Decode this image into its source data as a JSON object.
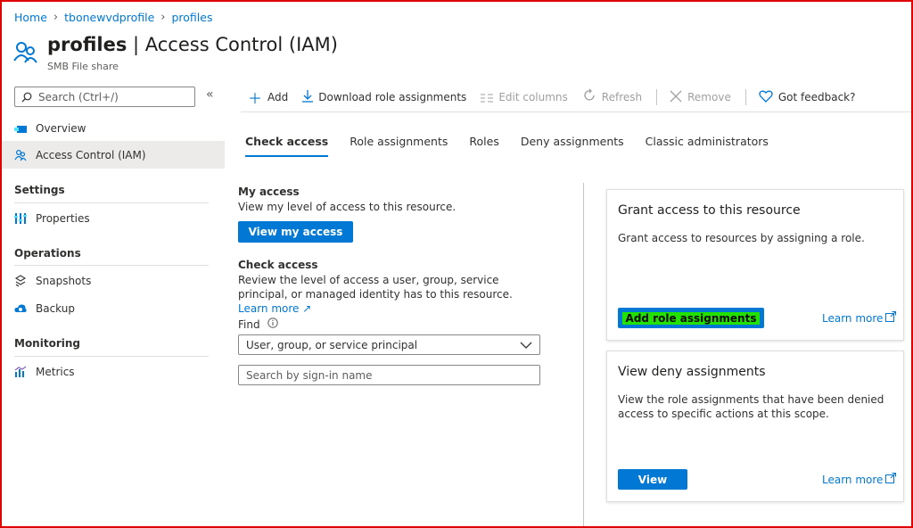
{
  "breadcrumb": [
    "Home",
    "tbonewvdprofile",
    "profiles"
  ],
  "header": {
    "title_bold": "profiles",
    "title_rest": "| Access Control (IAM)",
    "subtitle": "SMB File share"
  },
  "sidebar": {
    "search_placeholder": "Search (Ctrl+/)",
    "collapse_glyph": "«",
    "items": [
      {
        "label": "Overview",
        "icon": "file-share-icon"
      },
      {
        "label": "Access Control (IAM)",
        "icon": "people-icon",
        "active": true
      }
    ],
    "sections": [
      {
        "heading": "Settings",
        "items": [
          {
            "label": "Properties",
            "icon": "properties-icon"
          }
        ]
      },
      {
        "heading": "Operations",
        "items": [
          {
            "label": "Snapshots",
            "icon": "snapshots-icon"
          },
          {
            "label": "Backup",
            "icon": "backup-icon"
          }
        ]
      },
      {
        "heading": "Monitoring",
        "items": [
          {
            "label": "Metrics",
            "icon": "metrics-icon"
          }
        ]
      }
    ]
  },
  "toolbar": {
    "add": "Add",
    "download": "Download role assignments",
    "edit_columns": "Edit columns",
    "refresh": "Refresh",
    "remove": "Remove",
    "feedback": "Got feedback?"
  },
  "tabs": [
    "Check access",
    "Role assignments",
    "Roles",
    "Deny assignments",
    "Classic administrators"
  ],
  "my_access": {
    "heading": "My access",
    "text": "View my level of access to this resource.",
    "button": "View my access"
  },
  "check_access": {
    "heading": "Check access",
    "text": "Review the level of access a user, group, service principal, or managed identity has to this resource.",
    "learn_more": "Learn more",
    "find_label": "Find",
    "find_value": "User, group, or service principal",
    "search_placeholder": "Search by sign-in name"
  },
  "grant_card": {
    "title": "Grant access to this resource",
    "text": "Grant access to resources by assigning a role.",
    "button": "Add role assignments",
    "learn_more": "Learn more"
  },
  "deny_card": {
    "title": "View deny assignments",
    "text": "View the role assignments that have been denied access to specific actions at this scope.",
    "button": "View",
    "learn_more": "Learn more"
  },
  "colors": {
    "accent": "#0078d4",
    "highlight": "#22e000",
    "frame": "#e00000",
    "active_nav": "#edebe9"
  }
}
